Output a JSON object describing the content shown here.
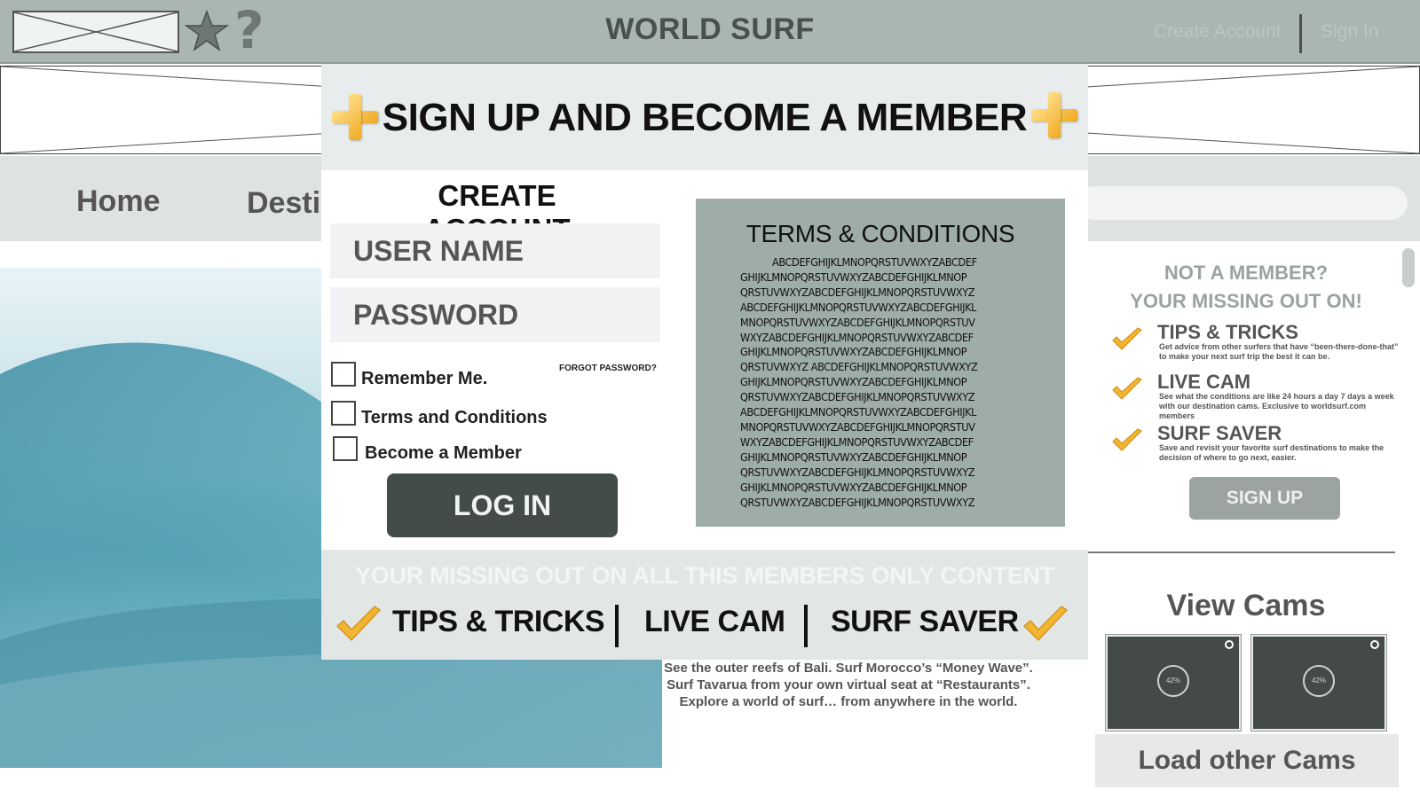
{
  "header": {
    "site_title": "WORLD SURF",
    "create_account_link": "Create Account",
    "sign_in_link": "Sign In",
    "icons": [
      "image-placeholder-icon",
      "star-icon",
      "help-icon"
    ]
  },
  "nav": {
    "items": [
      "Home",
      "Destinations"
    ]
  },
  "hero": {
    "caption_lines": [
      "See the outer reefs of Bali. Surf Morocco’s “Money Wave”.",
      "Surf Tavarua from your own virtual seat at “Restaurants”.",
      "Explore a world of surf… from anywhere in the world."
    ]
  },
  "sidebar": {
    "heading_line1": "NOT A MEMBER?",
    "heading_line2": "YOUR MISSING OUT ON!",
    "features": [
      {
        "title": "TIPS & TRICKS",
        "desc": "Get advice from other surfers that have “been-there-done-that” to make your next surf trip the best it can be."
      },
      {
        "title": "LIVE CAM",
        "desc": "See what the conditions are like 24 hours a day 7 days a week with our destination cams. Exclusive to worldsurf.com members"
      },
      {
        "title": "SURF SAVER",
        "desc": "Save and revisit your favorite surf destinations to make the decision of where to go next, easier."
      }
    ],
    "signup_button": "SIGN UP",
    "view_cams_title": "View Cams",
    "cams": [
      {
        "loading": "42%"
      },
      {
        "loading": "42%"
      }
    ],
    "load_cams_button": "Load other Cams"
  },
  "modal": {
    "title": "SIGN UP AND BECOME A MEMBER",
    "create_account_heading": "CREATE ACCOUNT",
    "username_placeholder": "USER NAME",
    "password_placeholder": "PASSWORD",
    "checkboxes": [
      {
        "label": "Remember Me.",
        "checked": false
      },
      {
        "label": "Terms and Conditions",
        "checked": false
      },
      {
        "label": "Become a Member",
        "checked": false
      }
    ],
    "forgot_password": "FORGOT PASSWORD?",
    "login_button": "LOG IN",
    "terms": {
      "title": "TERMS & CONDITIONS",
      "lines": [
        "ABCDEFGHIJKLMNOPQRSTUVWXYZABCDEF",
        "GHIJKLMNOPQRSTUVWXYZABCDEFGHIJKLMNOP",
        "QRSTUVWXYZABCDEFGHIJKLMNOPQRSTUVWXYZ",
        "ABCDEFGHIJKLMNOPQRSTUVWXYZABCDEFGHIJKL",
        "MNOPQRSTUVWXYZABCDEFGHIJKLMNOPQRSTUV",
        "WXYZABCDEFGHIJKLMNOPQRSTUVWXYZABCDEF",
        "GHIJKLMNOPQRSTUVWXYZABCDEFGHIJKLMNOP",
        "QRSTUVWXYZ ABCDEFGHIJKLMNOPQRSTUVWXYZ",
        "GHIJKLMNOPQRSTUVWXYZABCDEFGHIJKLMNOP",
        "QRSTUVWXYZABCDEFGHIJKLMNOPQRSTUVWXYZ",
        "ABCDEFGHIJKLMNOPQRSTUVWXYZABCDEFGHIJKL",
        "MNOPQRSTUVWXYZABCDEFGHIJKLMNOPQRSTUV",
        "WXYZABCDEFGHIJKLMNOPQRSTUVWXYZABCDEF",
        "GHIJKLMNOPQRSTUVWXYZABCDEFGHIJKLMNOP",
        "QRSTUVWXYZABCDEFGHIJKLMNOPQRSTUVWXYZ",
        "GHIJKLMNOPQRSTUVWXYZABCDEFGHIJKLMNOP",
        "QRSTUVWXYZABCDEFGHIJKLMNOPQRSTUVWXYZ"
      ]
    },
    "footer_tagline": "YOUR MISSING OUT ON ALL THIS MEMBERS ONLY CONTENT",
    "footer_features": [
      "TIPS & TRICKS",
      "LIVE CAM",
      "SURF SAVER"
    ]
  },
  "colors": {
    "topbar": "#a9b6b4",
    "modal_header": "#e8ecec",
    "terms_box": "#9eacaa",
    "login_button": "#434b4b",
    "accent_gold": "#f0a820"
  }
}
